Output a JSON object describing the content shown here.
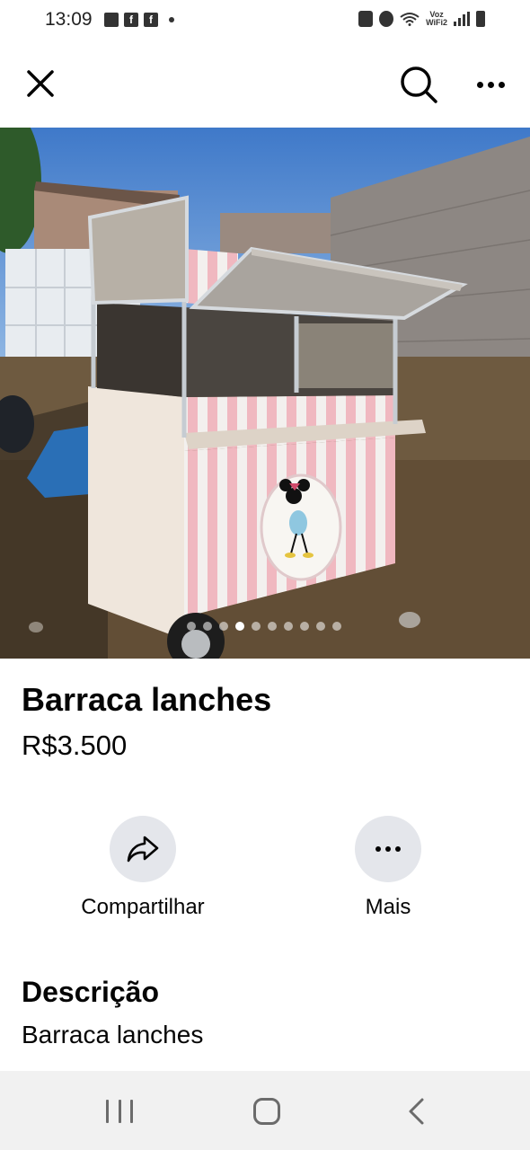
{
  "status_bar": {
    "time": "13:09",
    "left_icons": [
      "gallery-icon",
      "facebook-icon",
      "facebook-icon",
      "notification-dot-icon"
    ],
    "right_icons": [
      "alarm-lock-icon",
      "alarm-icon",
      "wifi-icon",
      "signal-icon",
      "battery-icon"
    ],
    "voz_wifi_line1": "Voz",
    "voz_wifi_line2": "WiFi2"
  },
  "app_bar": {
    "close_icon": "close-icon",
    "search_icon": "search-icon",
    "more_icon": "more-horizontal-icon"
  },
  "photo": {
    "subject": "Barraca lanches cart photo",
    "pager_count": 10,
    "pager_active_index": 3
  },
  "listing": {
    "title": "Barraca lanches",
    "price": "R$3.500"
  },
  "actions": [
    {
      "label": "Compartilhar",
      "icon": "share-icon"
    },
    {
      "label": "Mais",
      "icon": "more-horizontal-icon"
    }
  ],
  "description": {
    "heading": "Descrição",
    "text": "Barraca lanches"
  },
  "nav_bar": {
    "recents_icon": "recents-icon",
    "home_icon": "home-icon",
    "back_icon": "back-icon"
  },
  "colors": {
    "text": "#050505",
    "action_circle": "#e4e6eb",
    "nav_bar_bg": "#f1f1f1",
    "cart_stripe_pink": "#f0b8c0"
  }
}
